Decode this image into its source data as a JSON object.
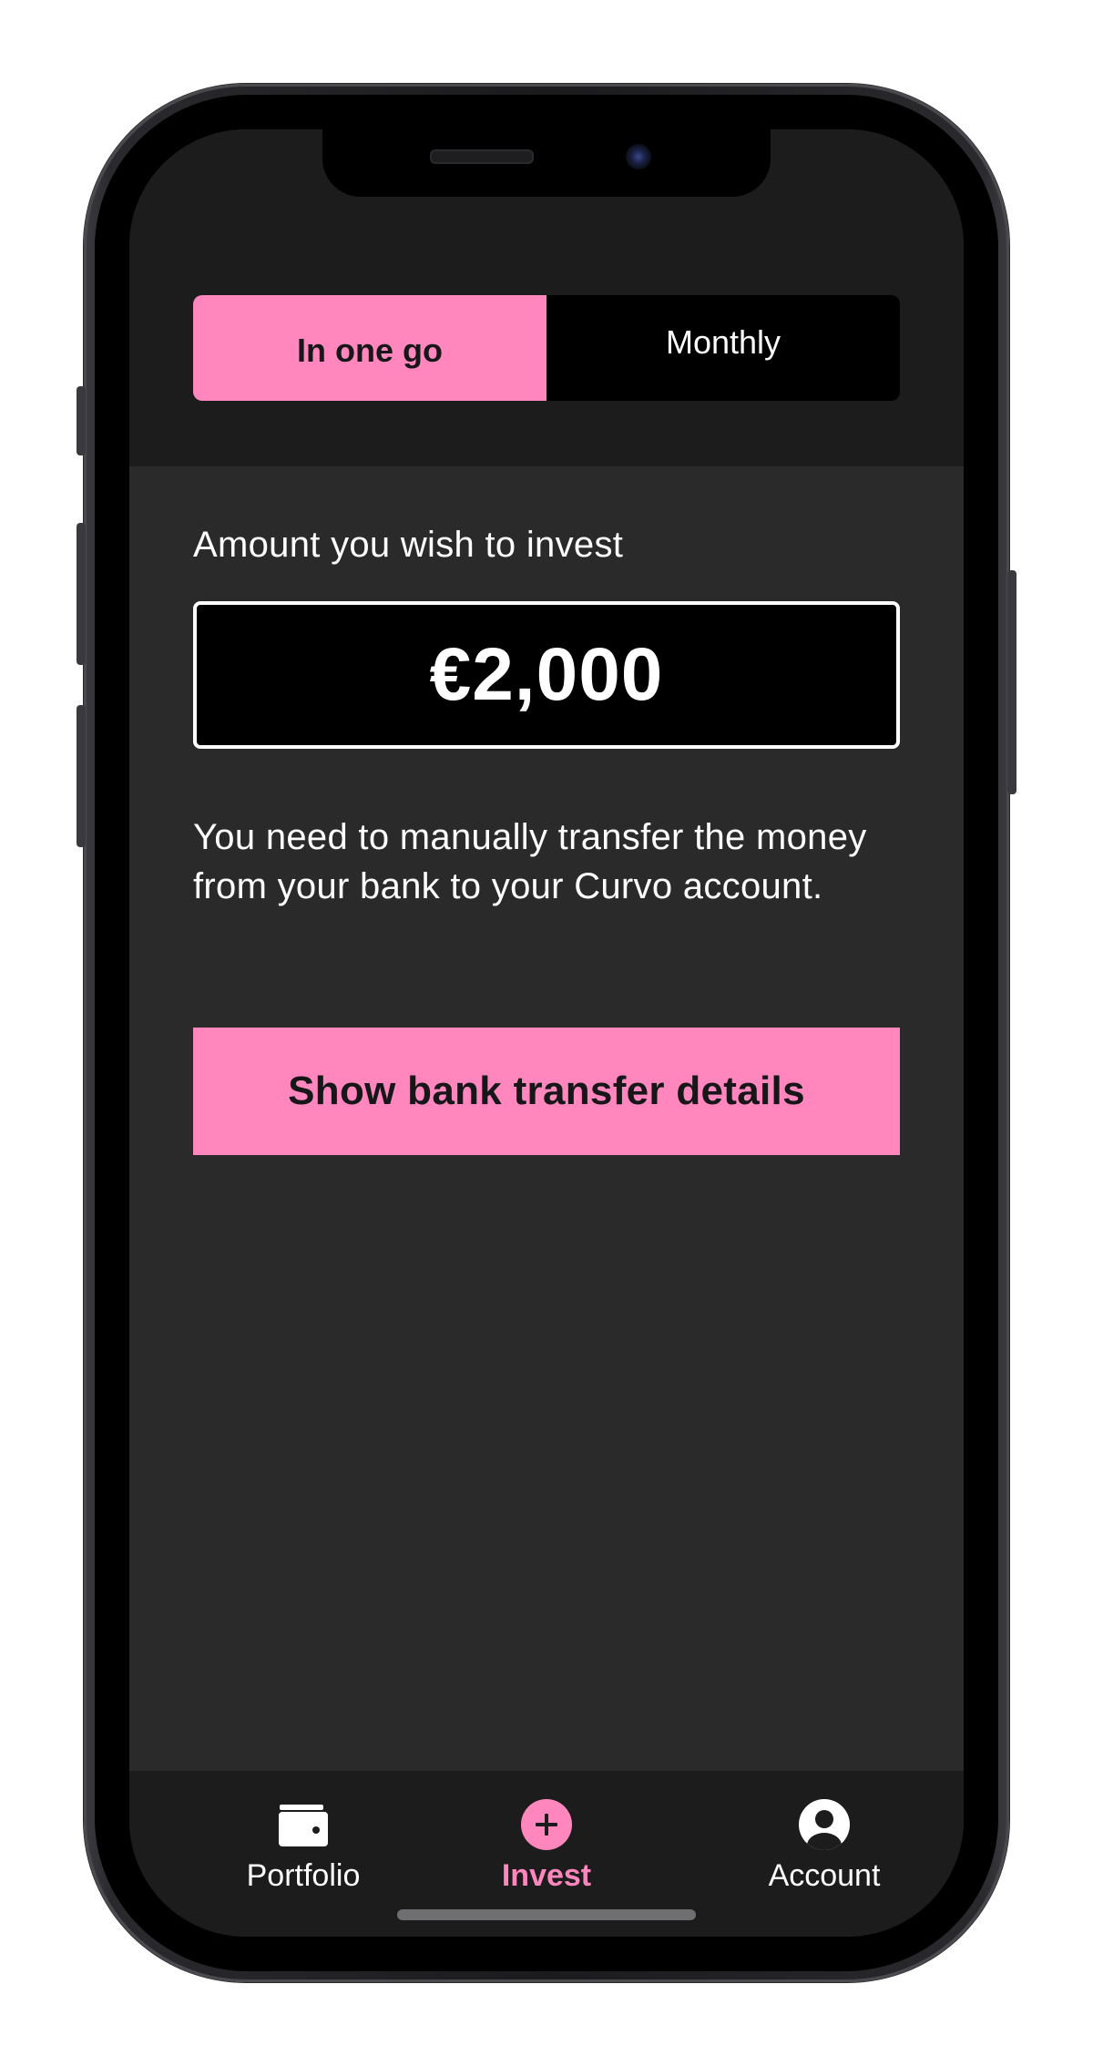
{
  "segmented_control": {
    "options": [
      {
        "label": "In one go",
        "selected": true
      },
      {
        "label": "Monthly",
        "selected": false
      }
    ]
  },
  "amount": {
    "label": "Amount you wish to invest",
    "value": "€2,000"
  },
  "info": {
    "text": "You need to manually transfer the money from your bank to your Curvo account."
  },
  "cta": {
    "label": "Show bank transfer details"
  },
  "bottom_nav": {
    "items": [
      {
        "label": "Portfolio",
        "icon": "wallet-icon",
        "active": false
      },
      {
        "label": "Invest",
        "icon": "plus-circle-icon",
        "active": true
      },
      {
        "label": "Account",
        "icon": "user-circle-icon",
        "active": false
      }
    ]
  },
  "colors": {
    "accent": "#ff87bd",
    "screen_background": "#2a2a2a",
    "header_background": "#1c1c1c",
    "input_background": "#000000",
    "text": "#ffffff"
  }
}
